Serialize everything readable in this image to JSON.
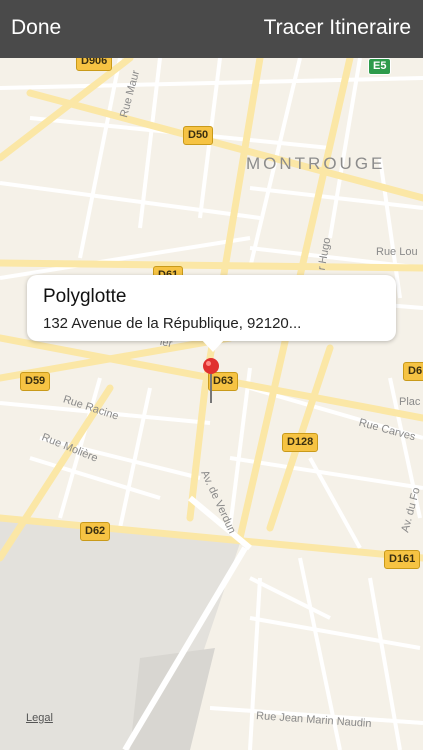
{
  "topbar": {
    "done_label": "Done",
    "route_label": "Tracer Itineraire"
  },
  "callout": {
    "title": "Polyglotte",
    "address": "132 Avenue de la République, 92120..."
  },
  "map": {
    "city": "MONTROUGE",
    "shields": {
      "d906": "D906",
      "e5": "E5",
      "d50": "D50",
      "d61": "D61",
      "d59": "D59",
      "d63": "D63",
      "d6x": "D6",
      "d128": "D128",
      "d62": "D62",
      "d161": "D161"
    },
    "streets": {
      "rue_maurice": "Rue Maur",
      "av_victor_hugo": "r Hugo",
      "rue_lou": "Rue Lou",
      "rue_racine": "Rue Racine",
      "rue_moliere": "Rue Molière",
      "av_de_verdun": "Av. de Verdun",
      "rue_carves": "Rue Carves",
      "av_du_fort": "Av. du Fo",
      "plac": "Plac",
      "rue_jean_marin": "Rue Jean Marin Naudin",
      "ier": "ier"
    },
    "legal_label": "Legal"
  }
}
